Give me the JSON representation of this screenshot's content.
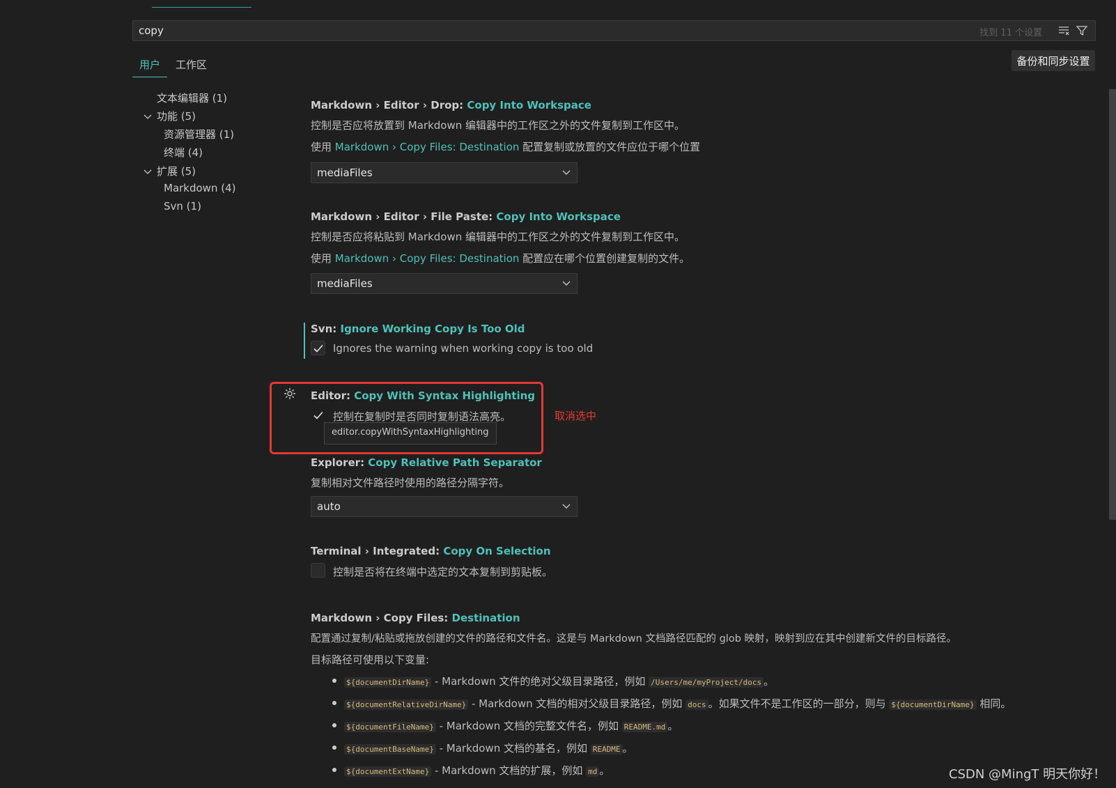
{
  "search": {
    "value": "copy",
    "result_count": "找到 11 个设置"
  },
  "tabs": [
    {
      "label": "用户"
    },
    {
      "label": "工作区"
    }
  ],
  "sync_button": "备份和同步设置",
  "toc": [
    {
      "label": "文本编辑器 (1)"
    },
    {
      "label": "功能 (5)"
    },
    {
      "label": "资源管理器 (1)"
    },
    {
      "label": "终端 (4)"
    },
    {
      "label": "扩展 (5)"
    },
    {
      "label": "Markdown (4)"
    },
    {
      "label": "Svn (1)"
    }
  ],
  "settings": {
    "drop": {
      "prefix": "Markdown › Editor › Drop: ",
      "name": "Copy Into Workspace",
      "desc": "控制是否应将放置到 Markdown 编辑器中的工作区之外的文件复制到工作区中。",
      "note_pre": "使用 ",
      "note_link": "Markdown › Copy Files: Destination",
      "note_post": " 配置复制或放置的文件应位于哪个位置",
      "value": "mediaFiles"
    },
    "paste": {
      "prefix": "Markdown › Editor › File Paste: ",
      "name": "Copy Into Workspace",
      "desc": "控制是否应将粘贴到 Markdown 编辑器中的工作区之外的文件复制到工作区中。",
      "note_pre": "使用 ",
      "note_link": "Markdown › Copy Files: Destination",
      "note_post": " 配置应在哪个位置创建复制的文件。",
      "value": "mediaFiles"
    },
    "svn": {
      "prefix": "Svn: ",
      "name": "Ignore Working Copy Is Too Old",
      "desc": "Ignores the warning when working copy is too old",
      "checked": true
    },
    "syntax": {
      "prefix": "Editor: ",
      "name": "Copy With Syntax Highlighting",
      "desc": "控制在复制时是否同时复制语法高亮。",
      "checked": true,
      "tooltip": "editor.copyWithSyntaxHighlighting"
    },
    "explorer": {
      "prefix": "Explorer: ",
      "name": "Copy Relative Path Separator",
      "desc": "复制相对文件路径时使用的路径分隔字符。",
      "value": "auto"
    },
    "terminal": {
      "prefix": "Terminal › Integrated: ",
      "name": "Copy On Selection",
      "desc": "控制是否将在终端中选定的文本复制到剪贴板。",
      "checked": false
    },
    "destination": {
      "prefix": "Markdown › Copy Files: ",
      "name": "Destination",
      "desc": "配置通过复制/粘贴或拖放创建的文件的路径和文件名。这是与 Markdown 文档路径匹配的 glob 映射，映射到应在其中创建新文件的目标路径。",
      "vars_intro": "目标路径可使用以下变量:",
      "bullets": [
        {
          "code": "${documentDirName}",
          "text": " - Markdown 文件的绝对父级目录路径，例如 ",
          "code2": "/Users/me/myProject/docs",
          "tail": "。"
        },
        {
          "code": "${documentRelativeDirName}",
          "text": " - Markdown 文档的相对父级目录路径，例如 ",
          "code2": "docs",
          "tail": "。如果文件不是工作区的一部分，则与 ",
          "code3": "${documentDirName}",
          "tail2": " 相同。"
        },
        {
          "code": "${documentFileName}",
          "text": " - Markdown 文档的完整文件名，例如 ",
          "code2": "README.md",
          "tail": "。"
        },
        {
          "code": "${documentBaseName}",
          "text": " - Markdown 文档的基名，例如 ",
          "code2": "README",
          "tail": "。"
        },
        {
          "code": "${documentExtName}",
          "text": " - Markdown 文档的扩展，例如 ",
          "code2": "md",
          "tail": "。"
        }
      ]
    }
  },
  "annotation": "取消选中",
  "watermark": "CSDN @MingT 明天你好！",
  "colors": {
    "accent": "#4fc1b9",
    "highlight_box": "#e53935",
    "background": "#1f1f1f"
  }
}
